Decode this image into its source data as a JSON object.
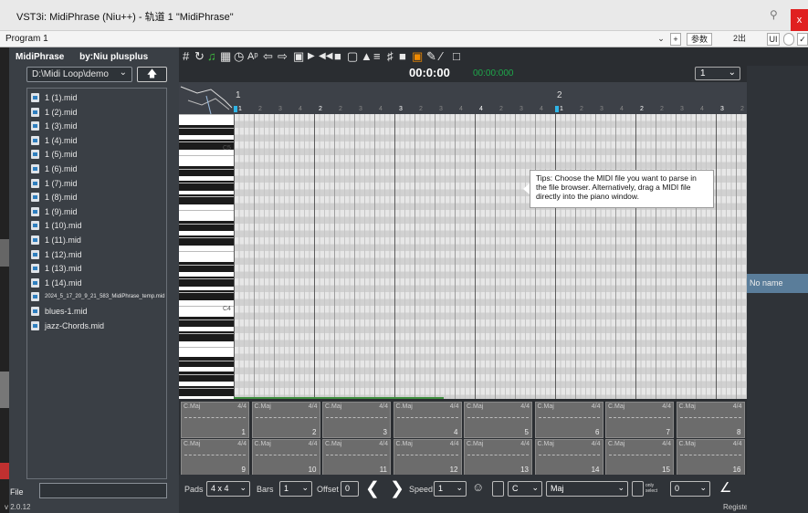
{
  "window": {
    "title": "VST3i: MidiPhrase (Niu++) - 轨道 1 \"MidiPhrase\"",
    "close_label": "x",
    "pin_icon": "pin-icon"
  },
  "program": {
    "name": "Program 1",
    "add_label": "+",
    "params_label": "参数",
    "out_label": "2出",
    "ui_label": "UI"
  },
  "plugin": {
    "name": "MidiPhrase",
    "author": "by:Niu plusplus",
    "version": "v 2.0.12"
  },
  "browser": {
    "path": "D:\\Midi Loop\\demo",
    "up_icon": "arrow-up-icon",
    "files": [
      "1 (1).mid",
      "1 (2).mid",
      "1 (3).mid",
      "1 (4).mid",
      "1 (5).mid",
      "1 (6).mid",
      "1 (7).mid",
      "1 (8).mid",
      "1 (9).mid",
      "1 (10).mid",
      "1 (11).mid",
      "1 (12).mid",
      "1 (13).mid",
      "1 (14).mid",
      "2024_5_17_20_9_21_583_MidiPhrase_temp.mid",
      "blues-1.mid",
      "jazz-Chords.mid"
    ],
    "file_label": "File",
    "file_value": ""
  },
  "transport": {
    "time": "00:0:00",
    "time_secondary": "00:00:000",
    "bars_value": "1"
  },
  "ruler": {
    "bars": [
      "1",
      "2"
    ],
    "beats": [
      "1",
      "2",
      "3",
      "4",
      "2",
      "2",
      "3",
      "4",
      "3",
      "2",
      "3",
      "4",
      "4",
      "2",
      "3",
      "4",
      "1",
      "2",
      "3",
      "4",
      "2",
      "2",
      "3",
      "4",
      "3",
      "2",
      "3",
      "4"
    ]
  },
  "piano": {
    "labels": [
      "C5",
      "C4"
    ]
  },
  "tip": "Tips: Choose the MIDI file you want to parse in the file browser. Alternatively, drag a MIDI file directly into the piano window.",
  "pads": {
    "chord": "C.Maj",
    "time_sig": "4/4",
    "numbers": [
      "1",
      "2",
      "3",
      "4",
      "5",
      "6",
      "7",
      "8",
      "9",
      "10",
      "11",
      "12",
      "13",
      "14",
      "15",
      "16"
    ]
  },
  "bottom": {
    "pads_label": "Pads",
    "pads_value": "4 x 4",
    "bars_label": "Bars",
    "bars_value": "1",
    "offset_label": "Offset",
    "offset_value": "0",
    "speed_label": "Speed",
    "speed_value": "1",
    "key_value": "C",
    "scale_value": "Maj",
    "only_label": "only select",
    "last_value": "0"
  },
  "register": "Register : niuplusplus",
  "right": {
    "track_name": "No name"
  },
  "colors": {
    "accent_blue": "#2fb4e6",
    "green": "#1ea84a",
    "close_red": "#e02020"
  }
}
